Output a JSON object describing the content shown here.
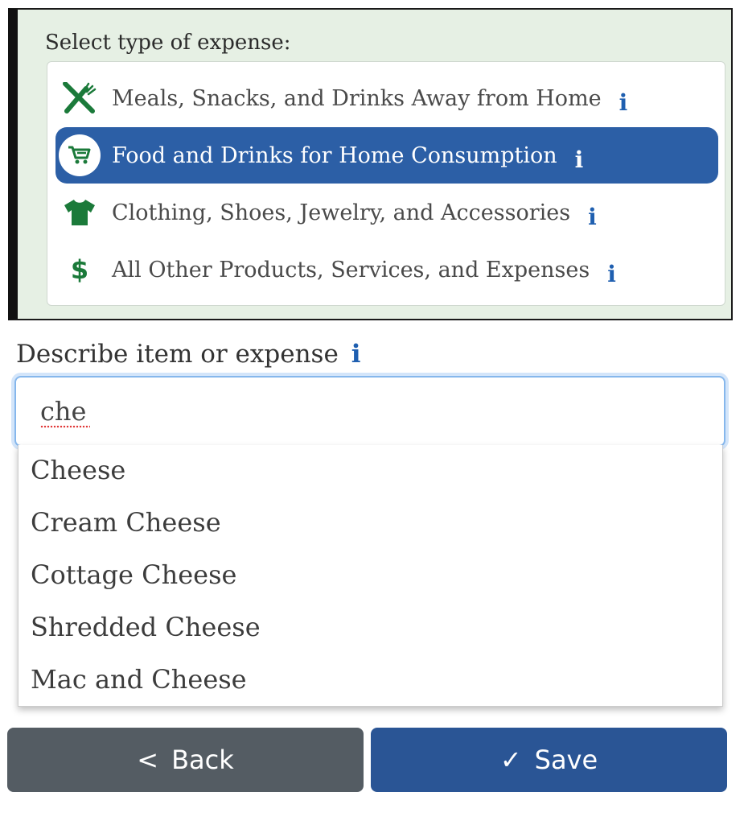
{
  "expense_type": {
    "title": "Select type of expense:",
    "options": [
      {
        "label": "Meals, Snacks, and Drinks Away from Home",
        "icon": "utensils-icon",
        "info": "i",
        "selected": false
      },
      {
        "label": "Food and Drinks for Home Consumption",
        "icon": "shopping-cart-icon",
        "info": "i",
        "selected": true
      },
      {
        "label": "Clothing, Shoes, Jewelry, and Accessories",
        "icon": "shirt-icon",
        "info": "i",
        "selected": false
      },
      {
        "label": "All Other Products, Services, and Expenses",
        "icon": "dollar-icon",
        "info": "i",
        "selected": false
      }
    ]
  },
  "describe": {
    "label": "Describe item or expense",
    "info": "i",
    "value": "che"
  },
  "suggestions": [
    "Cheese",
    "Cream Cheese",
    "Cottage Cheese",
    "Shredded Cheese",
    "Mac and Cheese"
  ],
  "buttons": {
    "back_glyph": "<",
    "back_label": "Back",
    "save_glyph": "✓",
    "save_label": "Save"
  },
  "colors": {
    "panel_bg": "#e6f0e4",
    "selected_bg": "#2c5fa6",
    "icon_green": "#1b7a3a",
    "info_blue": "#1f5fb0",
    "back_button": "#545c63",
    "save_button": "#2a5595"
  }
}
